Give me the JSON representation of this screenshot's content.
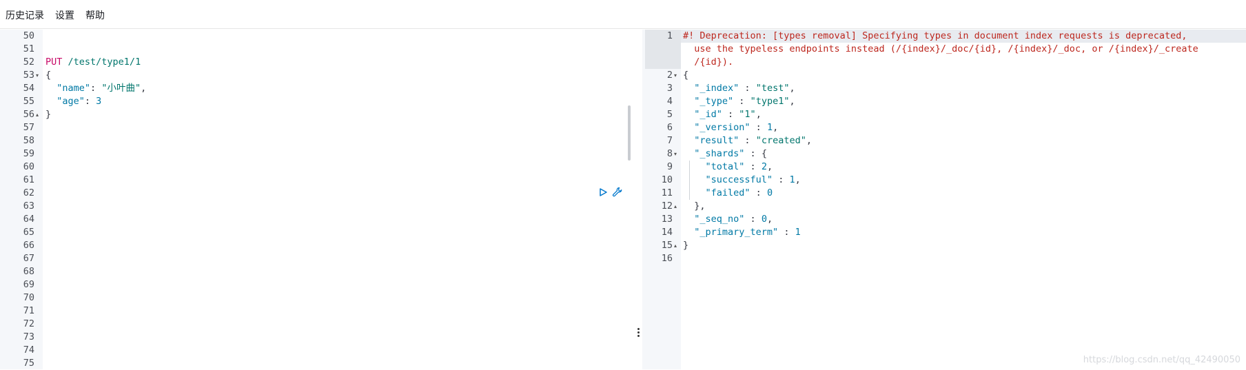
{
  "menu": {
    "history": "历史记录",
    "settings": "设置",
    "help": "帮助"
  },
  "left_editor": {
    "line_numbers": [
      "50",
      "51",
      "52",
      "53",
      "54",
      "55",
      "56",
      "57",
      "58",
      "59",
      "60",
      "61",
      "62",
      "63",
      "64",
      "65",
      "66",
      "67",
      "68",
      "69",
      "70",
      "71",
      "72",
      "73",
      "74",
      "75"
    ],
    "request": {
      "method": "PUT",
      "url": "/test/type1/1",
      "open_brace": "{",
      "close_brace": "}",
      "field1_key": "\"name\"",
      "field1_value": "\"小叶曲\"",
      "field2_key": "\"age\"",
      "field2_value": "3"
    },
    "icons": {
      "run": "play-icon",
      "settings": "wrench-icon"
    }
  },
  "right_editor": {
    "line_numbers": [
      "1",
      "2",
      "3",
      "4",
      "5",
      "6",
      "7",
      "8",
      "9",
      "10",
      "11",
      "12",
      "13",
      "14",
      "15",
      "16"
    ],
    "warning_lines": [
      "#! Deprecation: [types removal] Specifying types in document index requests is deprecated,",
      "  use the typeless endpoints instead (/{index}/_doc/{id}, /{index}/_doc, or /{index}/_create",
      "  /{id})."
    ],
    "response": {
      "open_brace": "{",
      "close_brace": "}",
      "index_key": "\"_index\"",
      "index_value": "\"test\"",
      "type_key": "\"_type\"",
      "type_value": "\"type1\"",
      "id_key": "\"_id\"",
      "id_value": "\"1\"",
      "version_key": "\"_version\"",
      "version_value": "1",
      "result_key": "\"result\"",
      "result_value": "\"created\"",
      "shards_key": "\"_shards\"",
      "shards_open": "{",
      "total_key": "\"total\"",
      "total_value": "2",
      "successful_key": "\"successful\"",
      "successful_value": "1",
      "failed_key": "\"failed\"",
      "failed_value": "0",
      "shards_close": "},",
      "seq_no_key": "\"_seq_no\"",
      "seq_no_value": "0",
      "primary_term_key": "\"_primary_term\"",
      "primary_term_value": "1"
    }
  },
  "watermark": "https://blog.csdn.net/qq_42490050",
  "colors": {
    "method": "#c80a68",
    "string": "#00756c",
    "key": "#0079a5",
    "warning": "#bd271e",
    "gutter": "#f5f7fa"
  }
}
